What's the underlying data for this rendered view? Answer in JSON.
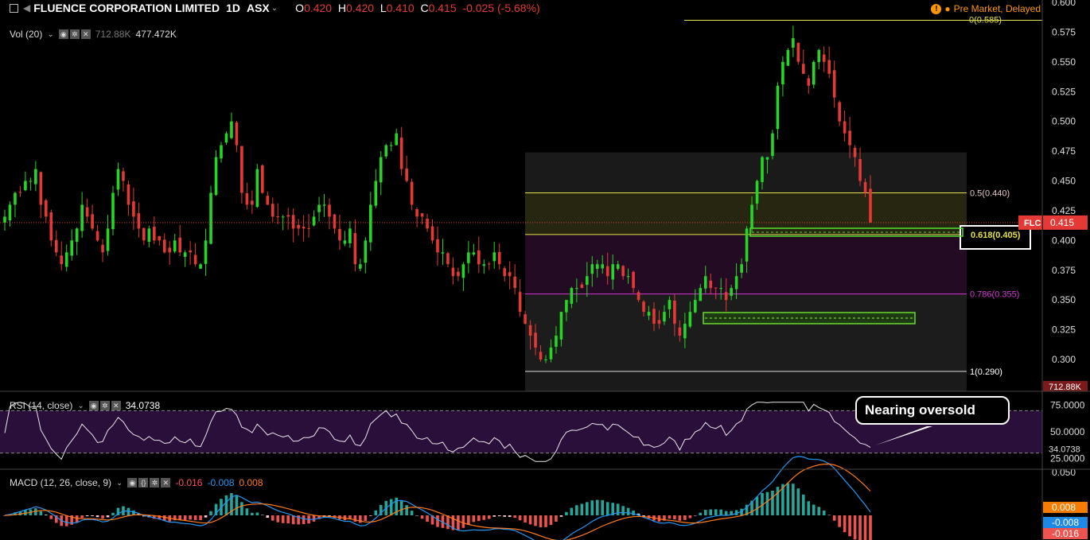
{
  "header": {
    "symbol": "FLUENCE CORPORATION LIMITED",
    "interval": "1D",
    "exchange": "ASX",
    "o_label": "O",
    "o_val": "0.420",
    "h_label": "H",
    "h_val": "0.420",
    "l_label": "L",
    "l_val": "0.410",
    "c_label": "C",
    "c_val": "0.415",
    "change": "-0.025 (-5.68%)",
    "status_text": "Pre Market, Delayed"
  },
  "vol": {
    "label": "Vol (20)",
    "v1": "712.88K",
    "v2": "477.472K",
    "axis_badge": "712.88K"
  },
  "rsi": {
    "label": "RSI (14, close)",
    "value": "34.0738",
    "badge": "34.0738"
  },
  "macd": {
    "label": "MACD (12, 26, close, 9)",
    "v1": "-0.016",
    "v2": "-0.008",
    "v3": "0.008",
    "badge_hist": "0.008",
    "badge_macd": "-0.008",
    "badge_signal": "-0.016"
  },
  "price_badge": {
    "sym": "FLC",
    "value": "0.415"
  },
  "fib": {
    "top_label": "0(0.585)",
    "mid_label": "0.5(0.440)",
    "box_label": "0.618(0.405)",
    "low_label": "0.786(0.355)",
    "bottom_label": "1(0.290)"
  },
  "annotation": "Nearing oversold",
  "colors": {
    "up": "#26d626",
    "down": "#e53935",
    "fib_yellow": "#e6e24a",
    "fib_magenta": "#d535d5",
    "rsi_fill": "#2b0f3b",
    "macd_line": "#2196f3",
    "signal_line": "#ff7a1a"
  },
  "chart_data": [
    {
      "type": "candlestick",
      "title": "FLUENCE CORPORATION LIMITED",
      "ylim": [
        0.28,
        0.6
      ],
      "y_ticks": [
        "0.600",
        "0.575",
        "0.550",
        "0.525",
        "0.500",
        "0.475",
        "0.450",
        "0.425",
        "0.400",
        "0.375",
        "0.350",
        "0.325",
        "0.300"
      ],
      "close": [
        0.42,
        0.43,
        0.44,
        0.44,
        0.45,
        0.45,
        0.46,
        0.43,
        0.42,
        0.4,
        0.39,
        0.38,
        0.39,
        0.4,
        0.41,
        0.43,
        0.42,
        0.41,
        0.4,
        0.39,
        0.41,
        0.44,
        0.46,
        0.45,
        0.43,
        0.42,
        0.41,
        0.4,
        0.41,
        0.4,
        0.4,
        0.39,
        0.39,
        0.4,
        0.39,
        0.39,
        0.39,
        0.38,
        0.38,
        0.4,
        0.44,
        0.47,
        0.48,
        0.49,
        0.5,
        0.48,
        0.44,
        0.43,
        0.43,
        0.46,
        0.44,
        0.43,
        0.42,
        0.42,
        0.42,
        0.42,
        0.41,
        0.41,
        0.41,
        0.41,
        0.42,
        0.43,
        0.43,
        0.42,
        0.41,
        0.4,
        0.4,
        0.41,
        0.38,
        0.38,
        0.4,
        0.43,
        0.45,
        0.47,
        0.48,
        0.48,
        0.49,
        0.46,
        0.45,
        0.43,
        0.42,
        0.42,
        0.41,
        0.4,
        0.39,
        0.39,
        0.38,
        0.37,
        0.37,
        0.38,
        0.39,
        0.39,
        0.38,
        0.38,
        0.38,
        0.39,
        0.38,
        0.37,
        0.37,
        0.36,
        0.34,
        0.33,
        0.32,
        0.31,
        0.3,
        0.3,
        0.31,
        0.32,
        0.34,
        0.35,
        0.36,
        0.36,
        0.36,
        0.37,
        0.38,
        0.38,
        0.38,
        0.37,
        0.38,
        0.38,
        0.37,
        0.37,
        0.36,
        0.35,
        0.34,
        0.34,
        0.33,
        0.33,
        0.34,
        0.35,
        0.33,
        0.32,
        0.33,
        0.34,
        0.35,
        0.36,
        0.37,
        0.36,
        0.36,
        0.36,
        0.35,
        0.36,
        0.37,
        0.38,
        0.41,
        0.43,
        0.45,
        0.47,
        0.47,
        0.49,
        0.53,
        0.55,
        0.56,
        0.57,
        0.55,
        0.54,
        0.53,
        0.55,
        0.56,
        0.55,
        0.54,
        0.52,
        0.5,
        0.49,
        0.48,
        0.47,
        0.45,
        0.44,
        0.415
      ]
    },
    {
      "type": "line",
      "title": "RSI (14, close)",
      "ylim": [
        20,
        80
      ],
      "y_ticks": [
        "75.0000",
        "50.0000",
        "25.0000"
      ],
      "bands": [
        70,
        30
      ],
      "last": 34.0738
    },
    {
      "type": "line",
      "title": "MACD (12, 26, close, 9)",
      "y_ticks": [
        "0.050"
      ],
      "last_macd": -0.008,
      "last_signal": -0.016,
      "last_hist": 0.008
    }
  ]
}
